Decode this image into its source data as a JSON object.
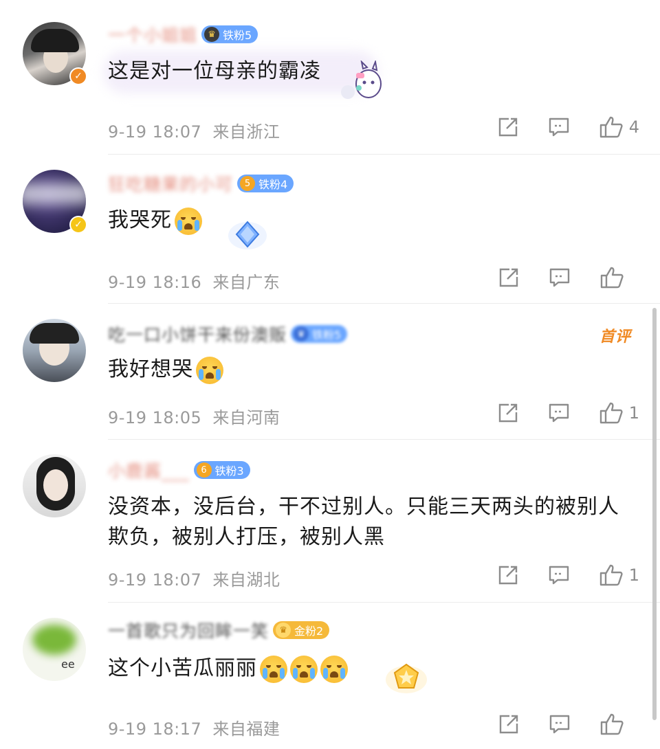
{
  "comments": [
    {
      "name": "一个小姐姐",
      "fan_badge": "铁粉5",
      "fan_level": "",
      "text": "这是对一位母亲的霸凌",
      "time": "9-19 18:07",
      "location": "来自浙江",
      "likes": "4",
      "tag": ""
    },
    {
      "name": "狂吃糖果的小可",
      "fan_badge": "铁粉4",
      "fan_level": "5",
      "text": "我哭死",
      "time": "9-19 18:16",
      "location": "来自广东",
      "likes": "",
      "tag": ""
    },
    {
      "name": "吃一口小饼干来份澳贩",
      "fan_badge": "铁粉5",
      "fan_level": "",
      "text": "我好想哭",
      "time": "9-19 18:05",
      "location": "来自河南",
      "likes": "1",
      "tag": "首评"
    },
    {
      "name": "小鹿酱___",
      "fan_badge": "铁粉3",
      "fan_level": "6",
      "text": "没资本，没后台，干不过别人。只能三天两头的被别人欺负，被别人打压，被别人黑",
      "time": "9-19 18:07",
      "location": "来自湖北",
      "likes": "1",
      "tag": ""
    },
    {
      "name": "一首歌只为回眸一笑",
      "fan_badge": "金粉2",
      "fan_level": "",
      "text": "这个小苦瓜丽丽",
      "time": "9-19 18:17",
      "location": "来自福建",
      "likes": "",
      "tag": ""
    }
  ],
  "icons": {
    "share": "share-icon",
    "reply": "comment-icon",
    "like": "thumbs-up-icon"
  },
  "colors": {
    "iron_badge": "#6aa6ff",
    "gold_badge": "#f5b93a",
    "verified_orange": "#f08a24",
    "verified_yellow": "#f5c518",
    "first_comment": "#f08a24"
  }
}
